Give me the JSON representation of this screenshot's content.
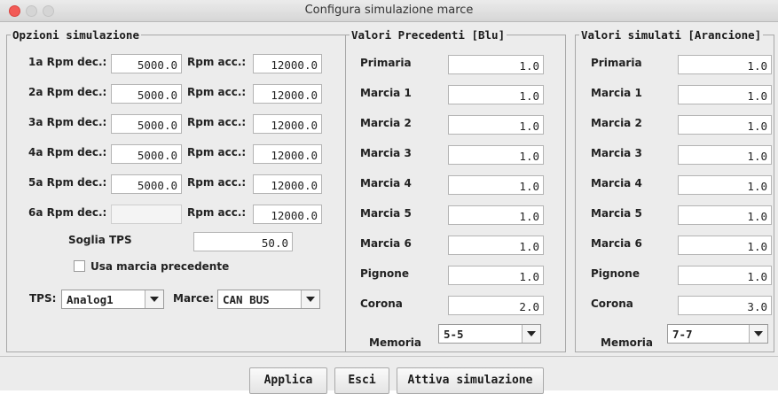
{
  "window": {
    "title": "Configura simulazione marce"
  },
  "options": {
    "legend": "Opzioni simulazione",
    "rows": [
      {
        "dec_label": "1a Rpm dec.:",
        "dec_value": "5000.0",
        "acc_label": "Rpm acc.:",
        "acc_value": "12000.0"
      },
      {
        "dec_label": "2a Rpm dec.:",
        "dec_value": "5000.0",
        "acc_label": "Rpm acc.:",
        "acc_value": "12000.0"
      },
      {
        "dec_label": "3a Rpm dec.:",
        "dec_value": "5000.0",
        "acc_label": "Rpm acc.:",
        "acc_value": "12000.0"
      },
      {
        "dec_label": "4a Rpm dec.:",
        "dec_value": "5000.0",
        "acc_label": "Rpm acc.:",
        "acc_value": "12000.0"
      },
      {
        "dec_label": "5a Rpm dec.:",
        "dec_value": "5000.0",
        "acc_label": "Rpm acc.:",
        "acc_value": "12000.0"
      },
      {
        "dec_label": "6a Rpm dec.:",
        "dec_value": "",
        "acc_label": "Rpm acc.:",
        "acc_value": "12000.0"
      }
    ],
    "tps_threshold_label": "Soglia TPS",
    "tps_threshold_value": "50.0",
    "use_previous_label": "Usa marcia precedente",
    "use_previous_checked": false,
    "tps_label": "TPS:",
    "tps_selected": "Analog1",
    "gears_label": "Marce:",
    "gears_selected": "CAN BUS"
  },
  "previous": {
    "legend": "Valori Precedenti [Blu]",
    "rows": [
      {
        "label": "Primaria",
        "value": "1.0"
      },
      {
        "label": "Marcia 1",
        "value": "1.0"
      },
      {
        "label": "Marcia 2",
        "value": "1.0"
      },
      {
        "label": "Marcia 3",
        "value": "1.0"
      },
      {
        "label": "Marcia 4",
        "value": "1.0"
      },
      {
        "label": "Marcia 5",
        "value": "1.0"
      },
      {
        "label": "Marcia 6",
        "value": "1.0"
      },
      {
        "label": "Pignone",
        "value": "1.0"
      },
      {
        "label": "Corona",
        "value": "2.0"
      }
    ],
    "memory_label": "Memoria",
    "memory_selected": "5-5"
  },
  "simulated": {
    "legend": "Valori simulati [Arancione]",
    "rows": [
      {
        "label": "Primaria",
        "value": "1.0"
      },
      {
        "label": "Marcia 1",
        "value": "1.0"
      },
      {
        "label": "Marcia 2",
        "value": "1.0"
      },
      {
        "label": "Marcia 3",
        "value": "1.0"
      },
      {
        "label": "Marcia 4",
        "value": "1.0"
      },
      {
        "label": "Marcia 5",
        "value": "1.0"
      },
      {
        "label": "Marcia 6",
        "value": "1.0"
      },
      {
        "label": "Pignone",
        "value": "1.0"
      },
      {
        "label": "Corona",
        "value": "3.0"
      }
    ],
    "memory_label": "Memoria",
    "memory_selected": "7-7"
  },
  "buttons": {
    "apply": "Applica",
    "exit": "Esci",
    "activate": "Attiva simulazione"
  },
  "colors": {
    "close_button": "#f25a56"
  }
}
